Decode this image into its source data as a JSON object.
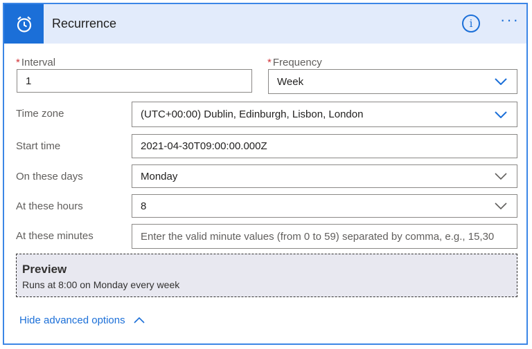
{
  "header": {
    "title": "Recurrence",
    "icon": "alarm-clock-icon",
    "info_label": "i",
    "more_label": "···"
  },
  "fields": {
    "interval": {
      "label": "Interval",
      "required": "*",
      "value": "1"
    },
    "frequency": {
      "label": "Frequency",
      "required": "*",
      "value": "Week"
    },
    "timezone": {
      "label": "Time zone",
      "value": "(UTC+00:00) Dublin, Edinburgh, Lisbon, London"
    },
    "start_time": {
      "label": "Start time",
      "value": "2021-04-30T09:00:00.000Z"
    },
    "days": {
      "label": "On these days",
      "value": "Monday"
    },
    "hours": {
      "label": "At these hours",
      "value": "8"
    },
    "minutes": {
      "label": "At these minutes",
      "placeholder": "Enter the valid minute values (from 0 to 59) separated by comma, e.g., 15,30"
    }
  },
  "preview": {
    "title": "Preview",
    "text": "Runs at 8:00 on Monday every week"
  },
  "advanced": {
    "label": "Hide advanced options"
  },
  "colors": {
    "accent": "#1b6fd8",
    "header_bg": "#e2ebfb",
    "required": "#d13438",
    "preview_bg": "#e8e8f0"
  }
}
